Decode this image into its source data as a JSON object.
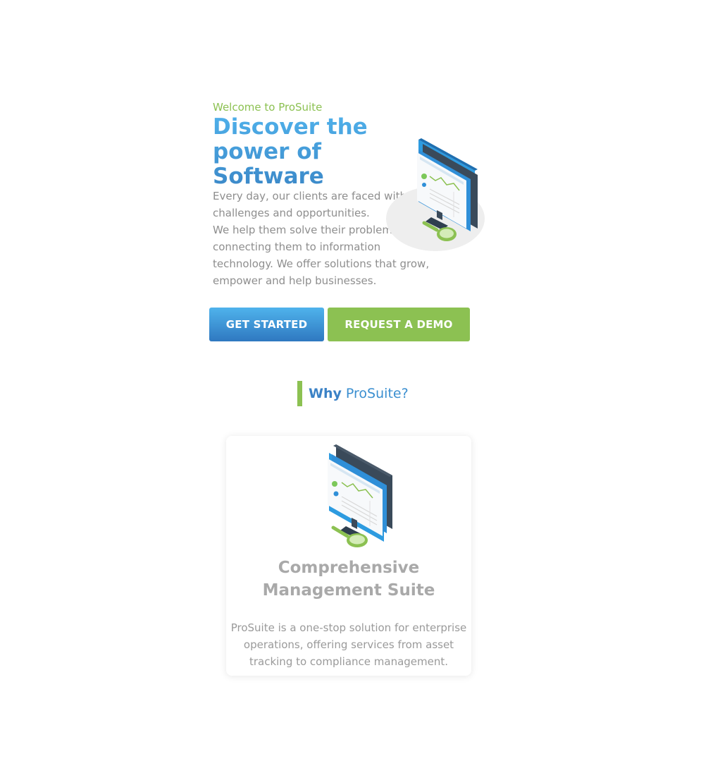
{
  "hero": {
    "eyebrow": "Welcome to ProSuite",
    "title": "Discover the power of Software",
    "body_line1": "Every day, our clients are faced with challenges and opportunities.",
    "body_line2": "We help them solve their problems by connecting them to information technology. We offer solutions that grow, empower and help businesses.",
    "illustration_icon": "monitor-dashboard-magnifier-illustration"
  },
  "actions": {
    "primary_label": "GET STARTED",
    "secondary_label": "REQUEST A DEMO"
  },
  "why": {
    "strong": "Why",
    "rest": " ProSuite?"
  },
  "feature": {
    "title": "Comprehensive Management Suite",
    "description": "ProSuite is a one-stop solution for enterprise operations, offering services from asset tracking to compliance management.",
    "illustration_icon": "monitor-dashboard-magnifier-illustration"
  },
  "colors": {
    "brand_blue": "#3b88c8",
    "brand_green": "#8cc152",
    "body_gray": "#8e8e8e"
  }
}
